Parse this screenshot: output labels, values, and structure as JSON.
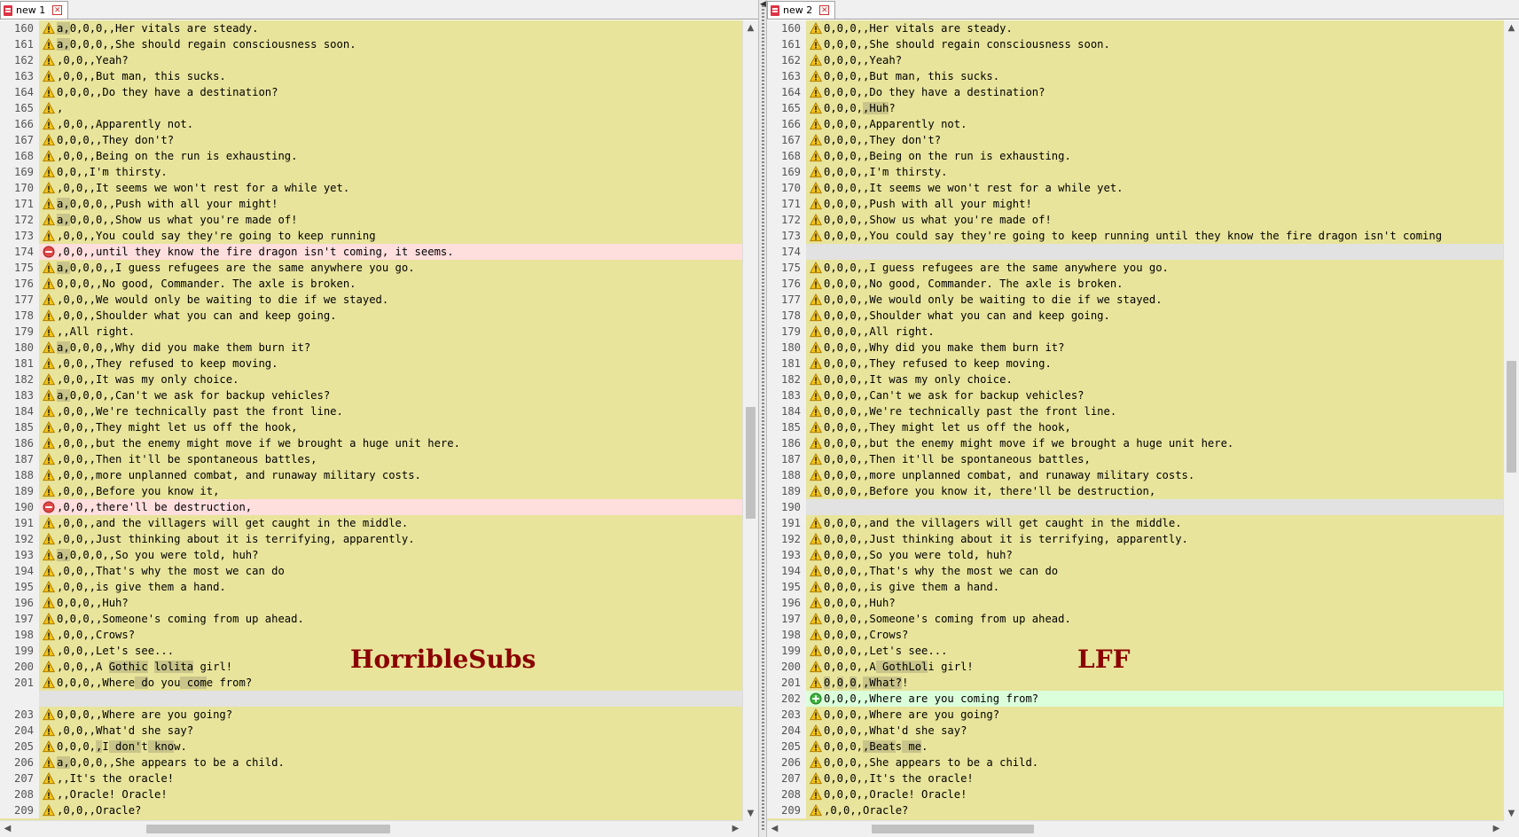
{
  "left": {
    "tab": "new 1",
    "watermark": "HorribleSubs",
    "lines": [
      {
        "n": "160",
        "m": "w",
        "t": "a,0,0,0,,Her vitals are steady.",
        "h": [
          [
            0,
            2
          ]
        ]
      },
      {
        "n": "161",
        "m": "w",
        "t": "a,0,0,0,,She should regain consciousness soon.",
        "h": [
          [
            0,
            2
          ]
        ]
      },
      {
        "n": "162",
        "m": "w",
        "t": ",0,0,,Yeah?"
      },
      {
        "n": "163",
        "m": "w",
        "t": ",0,0,,But man, this sucks."
      },
      {
        "n": "164",
        "m": "w",
        "t": "0,0,0,,Do they have a destination?"
      },
      {
        "n": "165",
        "m": "w",
        "t": ","
      },
      {
        "n": "166",
        "m": "w",
        "t": ",0,0,,Apparently not."
      },
      {
        "n": "167",
        "m": "w",
        "t": "0,0,0,,They don't?"
      },
      {
        "n": "168",
        "m": "w",
        "t": ",0,0,,Being on the run is exhausting."
      },
      {
        "n": "169",
        "m": "w",
        "t": "0,0,,I'm thirsty."
      },
      {
        "n": "170",
        "m": "w",
        "t": ",0,0,,It seems we won't rest for a while yet."
      },
      {
        "n": "171",
        "m": "w",
        "t": "a,0,0,0,,Push with all your might!",
        "h": [
          [
            0,
            2
          ]
        ]
      },
      {
        "n": "172",
        "m": "w",
        "t": "a,0,0,0,,Show us what you're made of!",
        "h": [
          [
            0,
            2
          ]
        ]
      },
      {
        "n": "173",
        "m": "w",
        "t": ",0,0,,You could say they're going to keep running"
      },
      {
        "n": "174",
        "m": "r",
        "t": ",0,0,,until they know the fire dragon isn't coming, it seems.",
        "cls": "removed"
      },
      {
        "n": "175",
        "m": "w",
        "t": "a,0,0,0,,I guess refugees are the same anywhere you go.",
        "h": [
          [
            0,
            2
          ]
        ]
      },
      {
        "n": "176",
        "m": "w",
        "t": "0,0,0,,No good, Commander. The axle is broken."
      },
      {
        "n": "177",
        "m": "w",
        "t": ",0,0,,We would only be waiting to die if we stayed."
      },
      {
        "n": "178",
        "m": "w",
        "t": ",0,0,,Shoulder what you can and keep going."
      },
      {
        "n": "179",
        "m": "w",
        "t": ",,All right."
      },
      {
        "n": "180",
        "m": "w",
        "t": "a,0,0,0,,Why did you make them burn it?",
        "h": [
          [
            0,
            2
          ]
        ]
      },
      {
        "n": "181",
        "m": "w",
        "t": ",0,0,,They refused to keep moving."
      },
      {
        "n": "182",
        "m": "w",
        "t": ",0,0,,It was my only choice."
      },
      {
        "n": "183",
        "m": "w",
        "t": "a,0,0,0,,Can't we ask for backup vehicles?",
        "h": [
          [
            0,
            2
          ]
        ]
      },
      {
        "n": "184",
        "m": "w",
        "t": ",0,0,,We're technically past the front line."
      },
      {
        "n": "185",
        "m": "w",
        "t": ",0,0,,They might let us off the hook,"
      },
      {
        "n": "186",
        "m": "w",
        "t": ",0,0,,but the enemy might move if we brought a huge unit here."
      },
      {
        "n": "187",
        "m": "w",
        "t": ",0,0,,Then it'll be spontaneous battles,"
      },
      {
        "n": "188",
        "m": "w",
        "t": ",0,0,,more unplanned combat, and runaway military costs."
      },
      {
        "n": "189",
        "m": "w",
        "t": ",0,0,,Before you know it,"
      },
      {
        "n": "190",
        "m": "r",
        "t": ",0,0,,there'll be destruction,",
        "cls": "removed"
      },
      {
        "n": "191",
        "m": "w",
        "t": ",0,0,,and the villagers will get caught in the middle."
      },
      {
        "n": "192",
        "m": "w",
        "t": ",0,0,,Just thinking about it is terrifying, apparently."
      },
      {
        "n": "193",
        "m": "w",
        "t": "a,0,0,0,,So you were told, huh?",
        "h": [
          [
            0,
            2
          ]
        ]
      },
      {
        "n": "194",
        "m": "w",
        "t": ",0,0,,That's why the most we can do"
      },
      {
        "n": "195",
        "m": "w",
        "t": ",0,0,,is give them a hand."
      },
      {
        "n": "196",
        "m": "w",
        "t": "0,0,0,,Huh?"
      },
      {
        "n": "197",
        "m": "w",
        "t": "0,0,0,,Someone's coming from up ahead."
      },
      {
        "n": "198",
        "m": "w",
        "t": ",0,0,,Crows?"
      },
      {
        "n": "199",
        "m": "w",
        "t": ",0,0,,Let's see..."
      },
      {
        "n": "200",
        "m": "w",
        "t": ",0,0,,A Gothic lolita girl!",
        "h": [
          [
            8,
            14
          ],
          [
            15,
            21
          ]
        ]
      },
      {
        "n": "201",
        "m": "w",
        "t": "0,0,0,,Where do you come from?",
        "h": [
          [
            12,
            14
          ],
          [
            19,
            23
          ]
        ]
      },
      {
        "n": "",
        "m": "",
        "t": "",
        "cls": "blank"
      },
      {
        "n": "203",
        "m": "w",
        "t": "0,0,0,,Where are you going?"
      },
      {
        "n": "204",
        "m": "w",
        "t": ",0,0,,What'd she say?"
      },
      {
        "n": "205",
        "m": "w",
        "t": "0,0,0,,I don't know.",
        "h": [
          [
            6,
            7
          ],
          [
            8,
            13
          ],
          [
            14,
            18
          ]
        ]
      },
      {
        "n": "206",
        "m": "w",
        "t": "a,0,0,0,,She appears to be a child.",
        "h": [
          [
            0,
            2
          ]
        ]
      },
      {
        "n": "207",
        "m": "w",
        "t": ",,It's the oracle!"
      },
      {
        "n": "208",
        "m": "w",
        "t": ",,Oracle! Oracle!"
      },
      {
        "n": "209",
        "m": "w",
        "t": ",0,0,,Oracle?"
      }
    ]
  },
  "right": {
    "tab": "new 2",
    "watermark": "LFF",
    "lines": [
      {
        "n": "160",
        "m": "w",
        "t": "0,0,0,,Her vitals are steady."
      },
      {
        "n": "161",
        "m": "w",
        "t": "0,0,0,,She should regain consciousness soon."
      },
      {
        "n": "162",
        "m": "w",
        "t": "0,0,0,,Yeah?"
      },
      {
        "n": "163",
        "m": "w",
        "t": "0,0,0,,But man, this sucks."
      },
      {
        "n": "164",
        "m": "w",
        "t": "0,0,0,,Do they have a destination?"
      },
      {
        "n": "165",
        "m": "w",
        "t": "0,0,0,,Huh?",
        "h": [
          [
            6,
            10
          ]
        ]
      },
      {
        "n": "166",
        "m": "w",
        "t": "0,0,0,,Apparently not."
      },
      {
        "n": "167",
        "m": "w",
        "t": "0,0,0,,They don't?"
      },
      {
        "n": "168",
        "m": "w",
        "t": "0,0,0,,Being on the run is exhausting."
      },
      {
        "n": "169",
        "m": "w",
        "t": "0,0,0,,I'm thirsty."
      },
      {
        "n": "170",
        "m": "w",
        "t": "0,0,0,,It seems we won't rest for a while yet."
      },
      {
        "n": "171",
        "m": "w",
        "t": "0,0,0,,Push with all your might!"
      },
      {
        "n": "172",
        "m": "w",
        "t": "0,0,0,,Show us what you're made of!"
      },
      {
        "n": "173",
        "m": "w",
        "t": "0,0,0,,You could say they're going to keep running until they know the fire dragon isn't coming"
      },
      {
        "n": "174",
        "m": "",
        "t": "",
        "cls": "blank"
      },
      {
        "n": "175",
        "m": "w",
        "t": "0,0,0,,I guess refugees are the same anywhere you go."
      },
      {
        "n": "176",
        "m": "w",
        "t": "0,0,0,,No good, Commander. The axle is broken."
      },
      {
        "n": "177",
        "m": "w",
        "t": "0,0,0,,We would only be waiting to die if we stayed."
      },
      {
        "n": "178",
        "m": "w",
        "t": "0,0,0,,Shoulder what you can and keep going."
      },
      {
        "n": "179",
        "m": "w",
        "t": "0,0,0,,All right."
      },
      {
        "n": "180",
        "m": "w",
        "t": "0,0,0,,Why did you make them burn it?"
      },
      {
        "n": "181",
        "m": "w",
        "t": "0,0,0,,They refused to keep moving."
      },
      {
        "n": "182",
        "m": "w",
        "t": "0,0,0,,It was my only choice."
      },
      {
        "n": "183",
        "m": "w",
        "t": "0,0,0,,Can't we ask for backup vehicles?"
      },
      {
        "n": "184",
        "m": "w",
        "t": "0,0,0,,We're technically past the front line."
      },
      {
        "n": "185",
        "m": "w",
        "t": "0,0,0,,They might let us off the hook,"
      },
      {
        "n": "186",
        "m": "w",
        "t": "0,0,0,,but the enemy might move if we brought a huge unit here."
      },
      {
        "n": "187",
        "m": "w",
        "t": "0,0,0,,Then it'll be spontaneous battles,"
      },
      {
        "n": "188",
        "m": "w",
        "t": "0,0,0,,more unplanned combat, and runaway military costs."
      },
      {
        "n": "189",
        "m": "w",
        "t": "0,0,0,,Before you know it, there'll be destruction,"
      },
      {
        "n": "190",
        "m": "",
        "t": "",
        "cls": "blank"
      },
      {
        "n": "191",
        "m": "w",
        "t": "0,0,0,,and the villagers will get caught in the middle."
      },
      {
        "n": "192",
        "m": "w",
        "t": "0,0,0,,Just thinking about it is terrifying, apparently."
      },
      {
        "n": "193",
        "m": "w",
        "t": "0,0,0,,So you were told, huh?"
      },
      {
        "n": "194",
        "m": "w",
        "t": "0,0,0,,That's why the most we can do"
      },
      {
        "n": "195",
        "m": "w",
        "t": "0,0,0,,is give them a hand."
      },
      {
        "n": "196",
        "m": "w",
        "t": "0,0,0,,Huh?"
      },
      {
        "n": "197",
        "m": "w",
        "t": "0,0,0,,Someone's coming from up ahead."
      },
      {
        "n": "198",
        "m": "w",
        "t": "0,0,0,,Crows?"
      },
      {
        "n": "199",
        "m": "w",
        "t": "0,0,0,,Let's see..."
      },
      {
        "n": "200",
        "m": "w",
        "t": "0,0,0,,A GothLoli girl!",
        "h": [
          [
            8,
            16
          ]
        ]
      },
      {
        "n": "201",
        "m": "w",
        "t": "0,0,0,,What?!",
        "h": [
          [
            0,
            1
          ],
          [
            2,
            3
          ],
          [
            4,
            5
          ],
          [
            6,
            12
          ]
        ]
      },
      {
        "n": "202",
        "m": "a",
        "t": "0,0,0,,Where are you coming from?",
        "cls": "added"
      },
      {
        "n": "203",
        "m": "w",
        "t": "0,0,0,,Where are you going?"
      },
      {
        "n": "204",
        "m": "w",
        "t": "0,0,0,,What'd she say?"
      },
      {
        "n": "205",
        "m": "w",
        "t": "0,0,0,,Beats me.",
        "h": [
          [
            6,
            11
          ],
          [
            12,
            15
          ]
        ]
      },
      {
        "n": "206",
        "m": "w",
        "t": "0,0,0,,She appears to be a child."
      },
      {
        "n": "207",
        "m": "w",
        "t": "0,0,0,,It's the oracle!"
      },
      {
        "n": "208",
        "m": "w",
        "t": "0,0,0,,Oracle! Oracle!"
      },
      {
        "n": "209",
        "m": "w",
        "t": ",0,0,,Oracle?"
      }
    ]
  },
  "colors": {
    "changed_bg": "#e8e49b",
    "removed_bg": "#ffdede",
    "added_bg": "#dbffdb",
    "blank_bg": "#e2e2e2",
    "watermark": "#8b0000"
  },
  "icons": {
    "changed": "warning-icon",
    "removed": "minus-circle-icon",
    "added": "plus-circle-icon"
  }
}
